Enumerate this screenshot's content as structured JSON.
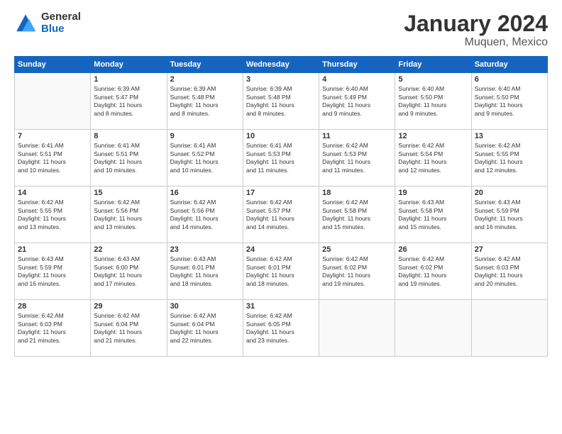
{
  "header": {
    "logo_general": "General",
    "logo_blue": "Blue",
    "title": "January 2024",
    "subtitle": "Muquen, Mexico"
  },
  "days_of_week": [
    "Sunday",
    "Monday",
    "Tuesday",
    "Wednesday",
    "Thursday",
    "Friday",
    "Saturday"
  ],
  "weeks": [
    [
      {
        "day": "",
        "info": ""
      },
      {
        "day": "1",
        "info": "Sunrise: 6:39 AM\nSunset: 5:47 PM\nDaylight: 11 hours\nand 8 minutes."
      },
      {
        "day": "2",
        "info": "Sunrise: 6:39 AM\nSunset: 5:48 PM\nDaylight: 11 hours\nand 8 minutes."
      },
      {
        "day": "3",
        "info": "Sunrise: 6:39 AM\nSunset: 5:48 PM\nDaylight: 11 hours\nand 8 minutes."
      },
      {
        "day": "4",
        "info": "Sunrise: 6:40 AM\nSunset: 5:49 PM\nDaylight: 11 hours\nand 9 minutes."
      },
      {
        "day": "5",
        "info": "Sunrise: 6:40 AM\nSunset: 5:50 PM\nDaylight: 11 hours\nand 9 minutes."
      },
      {
        "day": "6",
        "info": "Sunrise: 6:40 AM\nSunset: 5:50 PM\nDaylight: 11 hours\nand 9 minutes."
      }
    ],
    [
      {
        "day": "7",
        "info": "Sunrise: 6:41 AM\nSunset: 5:51 PM\nDaylight: 11 hours\nand 10 minutes."
      },
      {
        "day": "8",
        "info": "Sunrise: 6:41 AM\nSunset: 5:51 PM\nDaylight: 11 hours\nand 10 minutes."
      },
      {
        "day": "9",
        "info": "Sunrise: 6:41 AM\nSunset: 5:52 PM\nDaylight: 11 hours\nand 10 minutes."
      },
      {
        "day": "10",
        "info": "Sunrise: 6:41 AM\nSunset: 5:53 PM\nDaylight: 11 hours\nand 11 minutes."
      },
      {
        "day": "11",
        "info": "Sunrise: 6:42 AM\nSunset: 5:53 PM\nDaylight: 11 hours\nand 11 minutes."
      },
      {
        "day": "12",
        "info": "Sunrise: 6:42 AM\nSunset: 5:54 PM\nDaylight: 11 hours\nand 12 minutes."
      },
      {
        "day": "13",
        "info": "Sunrise: 6:42 AM\nSunset: 5:55 PM\nDaylight: 11 hours\nand 12 minutes."
      }
    ],
    [
      {
        "day": "14",
        "info": "Sunrise: 6:42 AM\nSunset: 5:55 PM\nDaylight: 11 hours\nand 13 minutes."
      },
      {
        "day": "15",
        "info": "Sunrise: 6:42 AM\nSunset: 5:56 PM\nDaylight: 11 hours\nand 13 minutes."
      },
      {
        "day": "16",
        "info": "Sunrise: 6:42 AM\nSunset: 5:56 PM\nDaylight: 11 hours\nand 14 minutes."
      },
      {
        "day": "17",
        "info": "Sunrise: 6:42 AM\nSunset: 5:57 PM\nDaylight: 11 hours\nand 14 minutes."
      },
      {
        "day": "18",
        "info": "Sunrise: 6:42 AM\nSunset: 5:58 PM\nDaylight: 11 hours\nand 15 minutes."
      },
      {
        "day": "19",
        "info": "Sunrise: 6:43 AM\nSunset: 5:58 PM\nDaylight: 11 hours\nand 15 minutes."
      },
      {
        "day": "20",
        "info": "Sunrise: 6:43 AM\nSunset: 5:59 PM\nDaylight: 11 hours\nand 16 minutes."
      }
    ],
    [
      {
        "day": "21",
        "info": "Sunrise: 6:43 AM\nSunset: 5:59 PM\nDaylight: 11 hours\nand 16 minutes."
      },
      {
        "day": "22",
        "info": "Sunrise: 6:43 AM\nSunset: 6:00 PM\nDaylight: 11 hours\nand 17 minutes."
      },
      {
        "day": "23",
        "info": "Sunrise: 6:43 AM\nSunset: 6:01 PM\nDaylight: 11 hours\nand 18 minutes."
      },
      {
        "day": "24",
        "info": "Sunrise: 6:42 AM\nSunset: 6:01 PM\nDaylight: 11 hours\nand 18 minutes."
      },
      {
        "day": "25",
        "info": "Sunrise: 6:42 AM\nSunset: 6:02 PM\nDaylight: 11 hours\nand 19 minutes."
      },
      {
        "day": "26",
        "info": "Sunrise: 6:42 AM\nSunset: 6:02 PM\nDaylight: 11 hours\nand 19 minutes."
      },
      {
        "day": "27",
        "info": "Sunrise: 6:42 AM\nSunset: 6:03 PM\nDaylight: 11 hours\nand 20 minutes."
      }
    ],
    [
      {
        "day": "28",
        "info": "Sunrise: 6:42 AM\nSunset: 6:03 PM\nDaylight: 11 hours\nand 21 minutes."
      },
      {
        "day": "29",
        "info": "Sunrise: 6:42 AM\nSunset: 6:04 PM\nDaylight: 11 hours\nand 21 minutes."
      },
      {
        "day": "30",
        "info": "Sunrise: 6:42 AM\nSunset: 6:04 PM\nDaylight: 11 hours\nand 22 minutes."
      },
      {
        "day": "31",
        "info": "Sunrise: 6:42 AM\nSunset: 6:05 PM\nDaylight: 11 hours\nand 23 minutes."
      },
      {
        "day": "",
        "info": ""
      },
      {
        "day": "",
        "info": ""
      },
      {
        "day": "",
        "info": ""
      }
    ]
  ]
}
